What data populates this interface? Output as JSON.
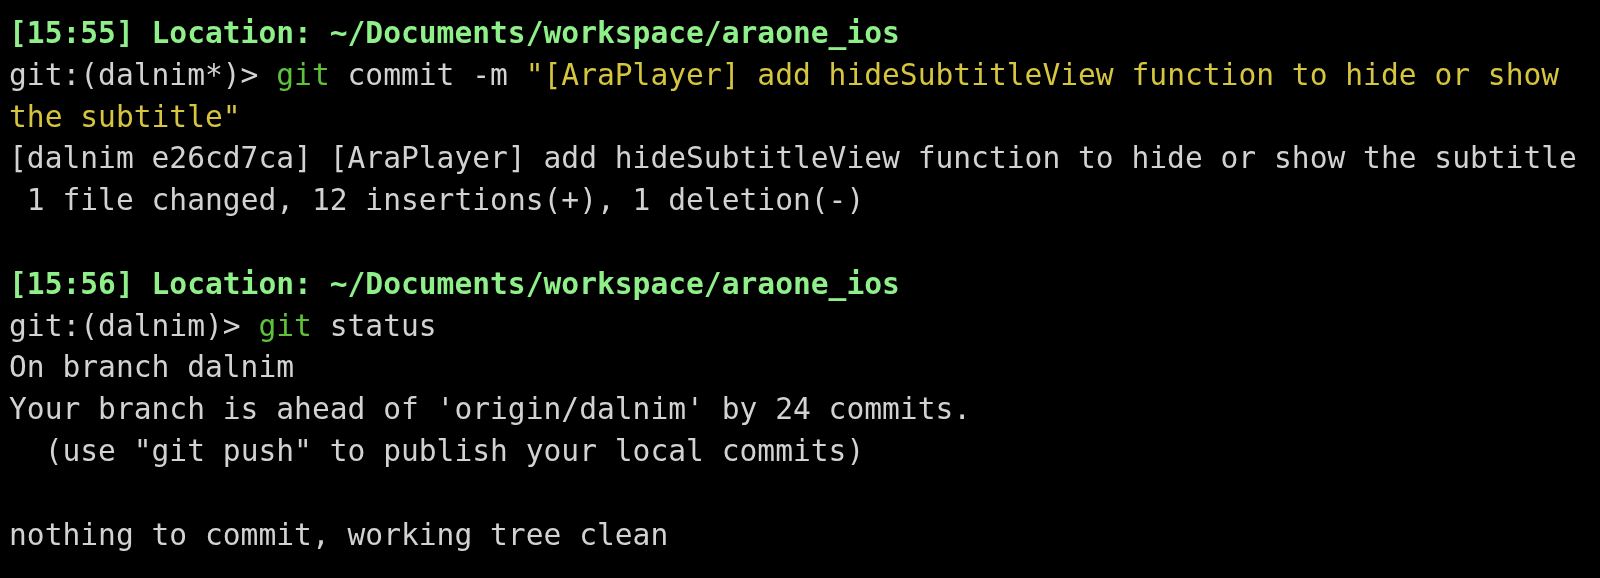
{
  "terminal": {
    "lines": [
      {
        "kind": "location",
        "text": "[15:55] Location: ~/Documents/workspace/araone_ios"
      },
      {
        "kind": "command",
        "prompt": "git:(dalnim*)> ",
        "program": "git",
        "args": " commit -m ",
        "message": "\"[AraPlayer] add hideSubtitleView function to hide or show the subtitle\""
      },
      {
        "kind": "output",
        "text": "[dalnim e26cd7ca] [AraPlayer] add hideSubtitleView function to hide or show the subtitle"
      },
      {
        "kind": "output",
        "text": " 1 file changed, 12 insertions(+), 1 deletion(-)"
      },
      {
        "kind": "blank"
      },
      {
        "kind": "location",
        "text": "[15:56] Location: ~/Documents/workspace/araone_ios"
      },
      {
        "kind": "command",
        "prompt": "git:(dalnim)> ",
        "program": "git",
        "args": " status"
      },
      {
        "kind": "output",
        "text": "On branch dalnim"
      },
      {
        "kind": "output",
        "text": "Your branch is ahead of 'origin/dalnim' by 24 commits."
      },
      {
        "kind": "output",
        "text": "  (use \"git push\" to publish your local commits)"
      },
      {
        "kind": "blank"
      },
      {
        "kind": "output",
        "text": "nothing to commit, working tree clean"
      }
    ]
  }
}
